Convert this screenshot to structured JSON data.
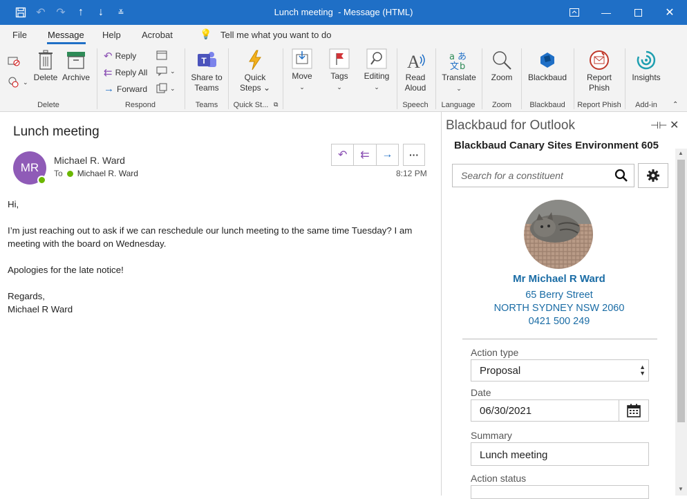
{
  "window": {
    "title": "Lunch meeting",
    "title_suffix": "-  Message (HTML)"
  },
  "menu": {
    "file": "File",
    "message": "Message",
    "help": "Help",
    "acrobat": "Acrobat",
    "tell_me": "Tell me what you want to do"
  },
  "ribbon": {
    "delete": "Delete",
    "archive": "Archive",
    "reply": "Reply",
    "reply_all": "Reply All",
    "forward": "Forward",
    "share_teams_1": "Share to",
    "share_teams_2": "Teams",
    "quick_steps_1": "Quick",
    "quick_steps_2": "Steps",
    "move": "Move",
    "tags": "Tags",
    "editing": "Editing",
    "read_aloud_1": "Read",
    "read_aloud_2": "Aloud",
    "translate": "Translate",
    "zoom": "Zoom",
    "blackbaud": "Blackbaud",
    "report_phish_1": "Report",
    "report_phish_2": "Phish",
    "insights": "Insights",
    "groups": {
      "delete": "Delete",
      "respond": "Respond",
      "teams": "Teams",
      "quick_steps": "Quick St...",
      "speech": "Speech",
      "language": "Language",
      "zoom": "Zoom",
      "blackbaud": "Blackbaud",
      "report_phish": "Report Phish",
      "addin": "Add-in"
    }
  },
  "message": {
    "subject": "Lunch meeting",
    "avatar_initials": "MR",
    "sender": "Michael R. Ward",
    "to_label": "To",
    "recipient": "Michael R. Ward",
    "time": "8:12 PM",
    "body": {
      "greeting": "Hi,",
      "para1": "I’m just reaching out to ask if we can reschedule our lunch meeting to the same time Tuesday? I am meeting with the board on Wednesday.",
      "para2": "Apologies for the late notice!",
      "closing": "Regards,",
      "signature": "Michael R Ward"
    }
  },
  "addin": {
    "title": "Blackbaud for Outlook",
    "environment": "Blackbaud Canary Sites Environment 605",
    "search_placeholder": "Search for a constituent",
    "constituent": {
      "name": "Mr Michael R Ward",
      "street": "65 Berry Street",
      "city": "NORTH SYDNEY NSW 2060",
      "phone": "0421 500 249"
    },
    "form": {
      "action_type_label": "Action type",
      "action_type_value": "Proposal",
      "date_label": "Date",
      "date_value": "06/30/2021",
      "summary_label": "Summary",
      "summary_value": "Lunch meeting",
      "action_status_label": "Action status"
    }
  },
  "colors": {
    "title_bar": "#1f6fc6",
    "avatar": "#8f5bb7",
    "link_blue": "#1a6ca5",
    "presence": "#6bb700"
  }
}
